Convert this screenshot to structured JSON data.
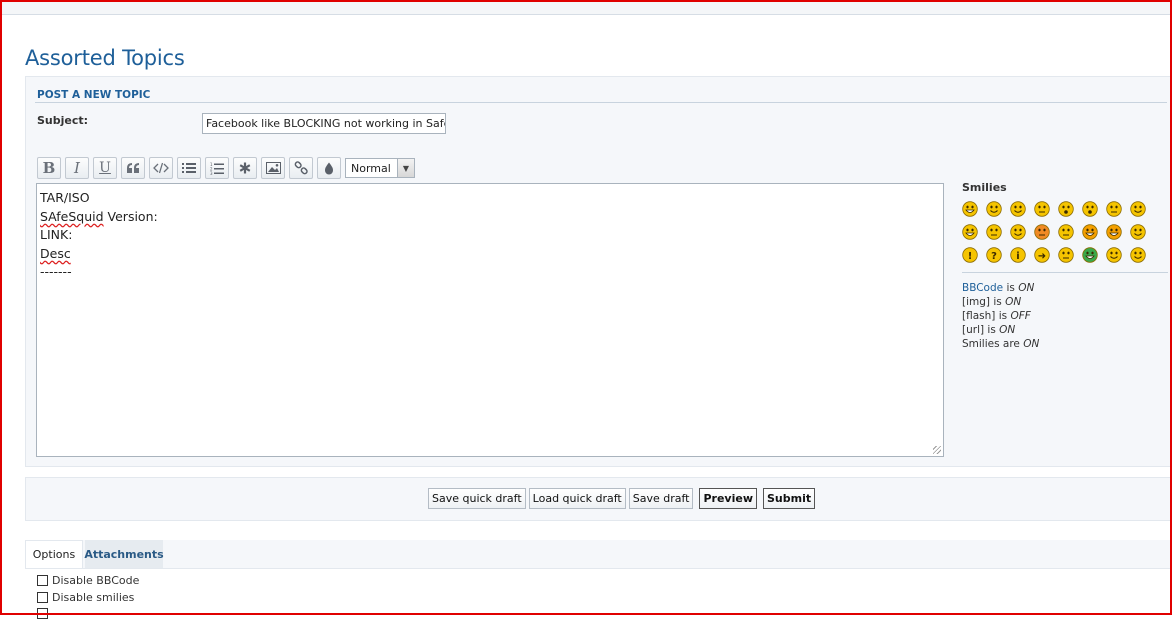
{
  "page": {
    "title": "Assorted Topics"
  },
  "form": {
    "heading": "POST A NEW TOPIC",
    "subject_label": "Subject:",
    "subject_value": "Facebook like BLOCKING not working in SafeSquid"
  },
  "toolbar": {
    "buttons": [
      {
        "name": "bold-button",
        "icon": "bold-icon",
        "label": "B"
      },
      {
        "name": "italic-button",
        "icon": "italic-icon",
        "label": "I"
      },
      {
        "name": "underline-button",
        "icon": "underline-icon",
        "label": "U"
      },
      {
        "name": "quote-button",
        "icon": "quote-icon"
      },
      {
        "name": "code-button",
        "icon": "code-icon"
      },
      {
        "name": "list-button",
        "icon": "list-icon"
      },
      {
        "name": "numbered-list-button",
        "icon": "numbered-list-icon"
      },
      {
        "name": "list-item-button",
        "icon": "asterisk-icon"
      },
      {
        "name": "image-button",
        "icon": "image-icon"
      },
      {
        "name": "link-button",
        "icon": "link-icon"
      },
      {
        "name": "color-button",
        "icon": "droplet-icon"
      }
    ],
    "font_size_selected": "Normal"
  },
  "editor": {
    "lines": [
      {
        "prefix": "",
        "spell": "",
        "rest": "TAR/ISO"
      },
      {
        "prefix": "",
        "spell": "SAfeSquid",
        "rest": " Version:"
      },
      {
        "prefix": "",
        "spell": "",
        "rest": "LINK:"
      },
      {
        "prefix": "",
        "spell": "Desc",
        "rest": ""
      },
      {
        "prefix": "",
        "spell": "",
        "rest": "-------"
      }
    ]
  },
  "sidebar": {
    "smilies_title": "Smilies",
    "smilies": [
      {
        "name": "biggrin",
        "face": "#f5c400",
        "mouth": "grin"
      },
      {
        "name": "smile",
        "face": "#f5c400",
        "mouth": "smile"
      },
      {
        "name": "wink",
        "face": "#f5c400",
        "mouth": "smile"
      },
      {
        "name": "sad",
        "face": "#f5c400",
        "mouth": "flat"
      },
      {
        "name": "surprised",
        "face": "#f5c400",
        "mouth": "open"
      },
      {
        "name": "eek",
        "face": "#f5c400",
        "mouth": "open"
      },
      {
        "name": "confused",
        "face": "#f5c400",
        "mouth": "flat"
      },
      {
        "name": "cool",
        "face": "#f5c400",
        "mouth": "smile"
      },
      {
        "name": "lol",
        "face": "#f5c400",
        "mouth": "grin"
      },
      {
        "name": "mad",
        "face": "#f5c400",
        "mouth": "flat"
      },
      {
        "name": "razz",
        "face": "#f5c400",
        "mouth": "smile"
      },
      {
        "name": "redface",
        "face": "#f08a24",
        "mouth": "flat"
      },
      {
        "name": "cry",
        "face": "#f5c400",
        "mouth": "flat"
      },
      {
        "name": "evil",
        "face": "#f5a000",
        "mouth": "grin"
      },
      {
        "name": "twisted",
        "face": "#f5a000",
        "mouth": "grin"
      },
      {
        "name": "rolleyes",
        "face": "#f5c400",
        "mouth": "smile"
      },
      {
        "name": "exclaim",
        "face": "#f5c400",
        "mouth": "mark-excl"
      },
      {
        "name": "question",
        "face": "#f5c400",
        "mouth": "mark-q"
      },
      {
        "name": "idea",
        "face": "#f5c400",
        "mouth": "mark-idea"
      },
      {
        "name": "arrow",
        "face": "#f5c400",
        "mouth": "mark-arrow"
      },
      {
        "name": "neutral",
        "face": "#f5c400",
        "mouth": "flat"
      },
      {
        "name": "mrgreen",
        "face": "#3aa84a",
        "mouth": "grin"
      },
      {
        "name": "geek",
        "face": "#f5c400",
        "mouth": "smile"
      },
      {
        "name": "uber-geek",
        "face": "#f5c400",
        "mouth": "smile"
      }
    ],
    "bbcode_link": "BBCode",
    "bbcode_is": " is ",
    "bbcode_state": "ON",
    "img_label": "[img] is ",
    "img_state": "ON",
    "flash_label": "[flash] is ",
    "flash_state": "OFF",
    "url_label": "[url] is ",
    "url_state": "ON",
    "smilies_label": "Smilies are ",
    "smilies_state": "ON"
  },
  "actions": {
    "save_quick_draft": "Save quick draft",
    "load_quick_draft": "Load quick draft",
    "save_draft": "Save draft",
    "preview": "Preview",
    "submit": "Submit"
  },
  "tabs": {
    "options": "Options",
    "attachments": "Attachments"
  },
  "options": {
    "disable_bbcode": "Disable BBCode",
    "disable_smilies": "Disable smilies"
  }
}
